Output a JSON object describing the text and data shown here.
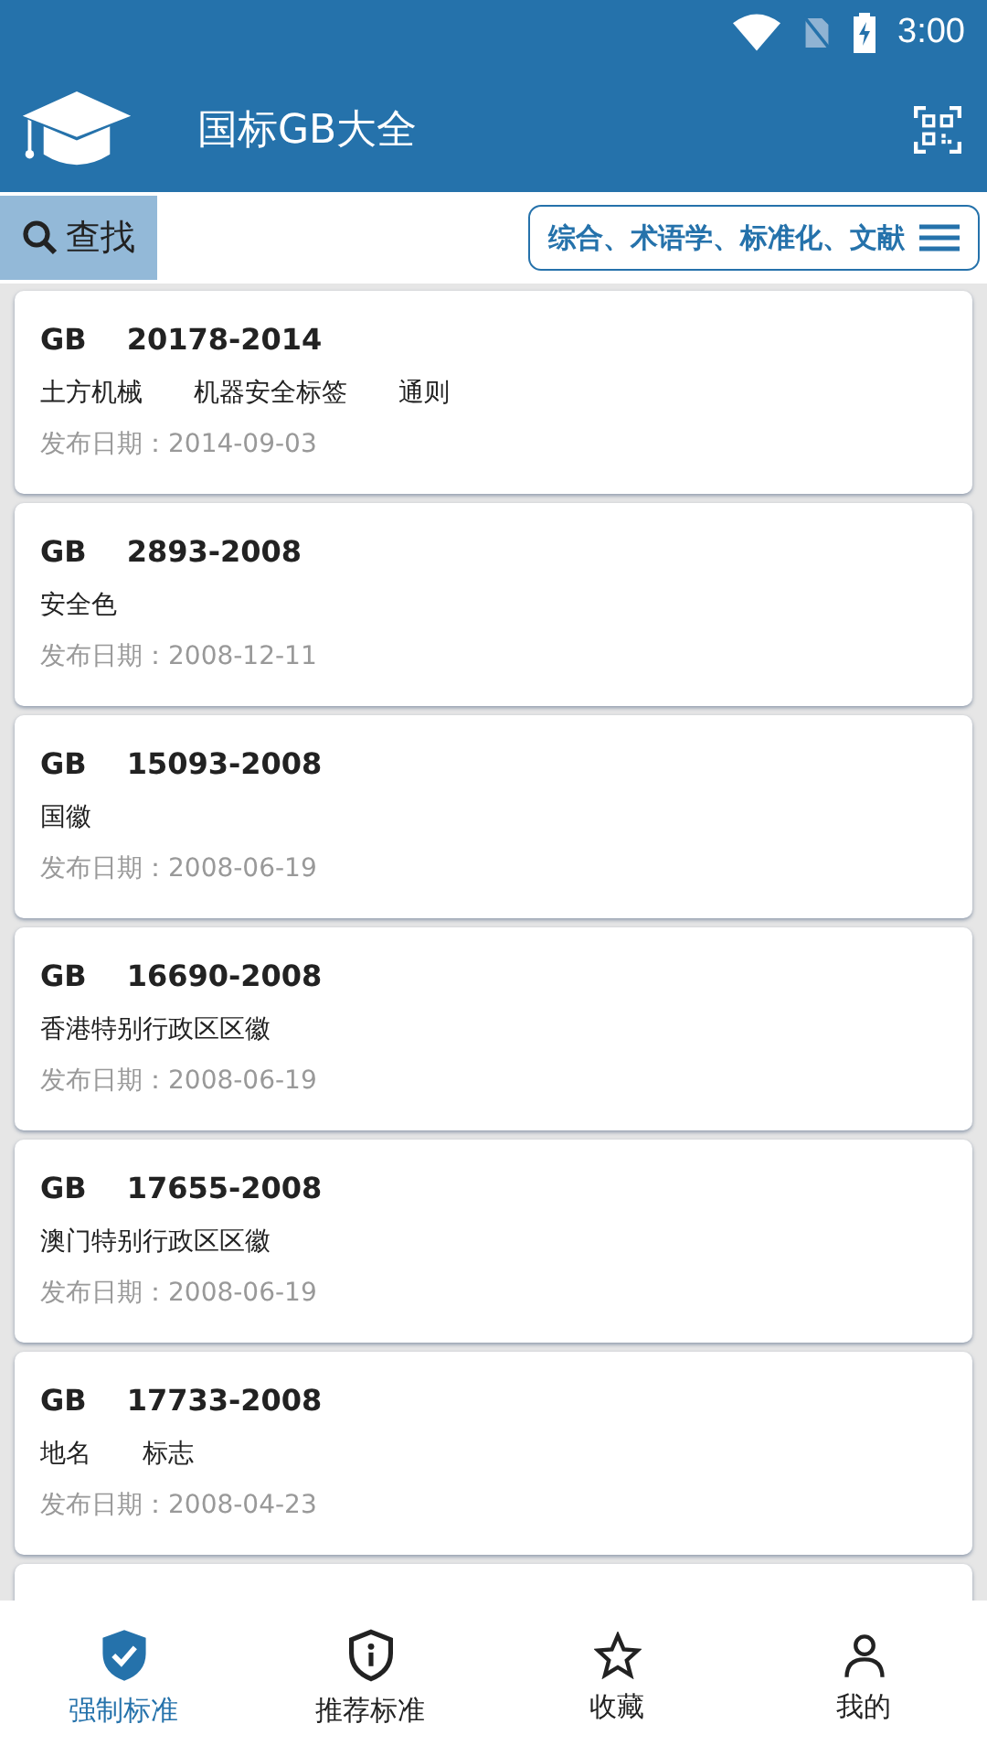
{
  "status_bar": {
    "time": "3:00"
  },
  "app_bar": {
    "title": "国标GB大全"
  },
  "search": {
    "label": "查找"
  },
  "category_filter": {
    "label": "综合、术语学、标准化、文献"
  },
  "standards": [
    {
      "prefix": "GB",
      "number": "20178-2014",
      "terms": [
        "土方机械",
        "机器安全标签",
        "通则"
      ],
      "date_label": "发布日期：",
      "date": "2014-09-03"
    },
    {
      "prefix": "GB",
      "number": "2893-2008",
      "terms": [
        "安全色"
      ],
      "date_label": "发布日期：",
      "date": "2008-12-11"
    },
    {
      "prefix": "GB",
      "number": "15093-2008",
      "terms": [
        "国徽"
      ],
      "date_label": "发布日期：",
      "date": "2008-06-19"
    },
    {
      "prefix": "GB",
      "number": "16690-2008",
      "terms": [
        "香港特别行政区区徽"
      ],
      "date_label": "发布日期：",
      "date": "2008-06-19"
    },
    {
      "prefix": "GB",
      "number": "17655-2008",
      "terms": [
        "澳门特别行政区区徽"
      ],
      "date_label": "发布日期：",
      "date": "2008-06-19"
    },
    {
      "prefix": "GB",
      "number": "17733-2008",
      "terms": [
        "地名",
        "标志"
      ],
      "date_label": "发布日期：",
      "date": "2008-04-23"
    }
  ],
  "bottom_nav": [
    {
      "kind": "shield-check",
      "label": "强制标准",
      "selected": true
    },
    {
      "kind": "shield-info",
      "label": "推荐标准",
      "selected": false
    },
    {
      "kind": "star",
      "label": "收藏",
      "selected": false
    },
    {
      "kind": "person",
      "label": "我的",
      "selected": false
    }
  ]
}
